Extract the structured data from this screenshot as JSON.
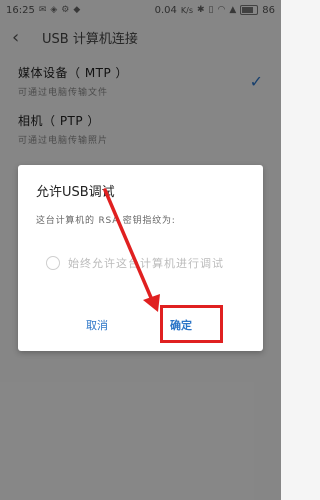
{
  "status_bar": {
    "time": "16:25",
    "speed": "0.04",
    "speed_unit": "K/s",
    "battery": "86"
  },
  "header": {
    "title": "USB 计算机连接"
  },
  "list": {
    "items": [
      {
        "title": "媒体设备（ MTP ）",
        "subtitle": "可通过电脑传输文件",
        "selected": true
      },
      {
        "title": "相机（ PTP ）",
        "subtitle": "可通过电脑传输照片",
        "selected": false
      }
    ]
  },
  "dialog": {
    "title": "允许USB调试",
    "message": "这台计算机的 RSA 密钥指纹为:",
    "checkbox_label": "始终允许这台计算机进行调试",
    "cancel_label": "取消",
    "ok_label": "确定"
  },
  "colors": {
    "accent": "#2a74c7",
    "annotation": "#e02020"
  }
}
